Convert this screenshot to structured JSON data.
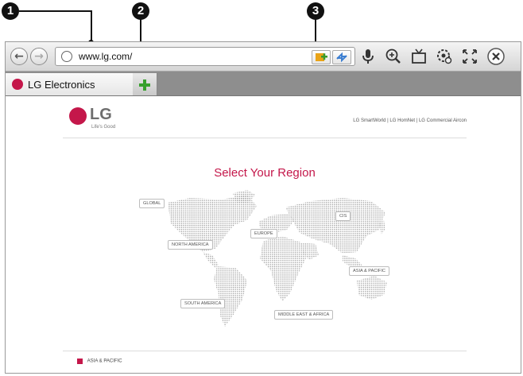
{
  "callouts": [
    "1",
    "2",
    "3"
  ],
  "browser": {
    "url": "www.lg.com/",
    "tab_title": "LG Electronics"
  },
  "toolbar_icons": [
    "back-icon",
    "forward-icon",
    "globe-icon",
    "bookmark-add-icon",
    "share-icon",
    "microphone-icon",
    "zoom-in-icon",
    "tv-icon",
    "settings-icon",
    "fullscreen-icon",
    "close-icon"
  ],
  "page": {
    "logo_text": "LG",
    "tagline": "Life's Good",
    "top_links": "LG SmartWorld | LG HomNet | LG Commercial Aircon",
    "heading": "Select Your Region",
    "regions": {
      "global": "GLOBAL",
      "north_america": "NORTH AMERICA",
      "europe": "EUROPE",
      "cis": "CIS",
      "asia_pacific": "ASIA & PACIFIC",
      "south_america": "SOUTH AMERICA",
      "middle_east_africa": "MIDDLE EAST & AFRICA"
    },
    "footer_item": "ASIA & PACIFIC"
  },
  "colors": {
    "brand": "#c4174a",
    "callout": "#111111",
    "toolbar": "#dcdcdc",
    "tabbar": "#8e8e8e"
  }
}
